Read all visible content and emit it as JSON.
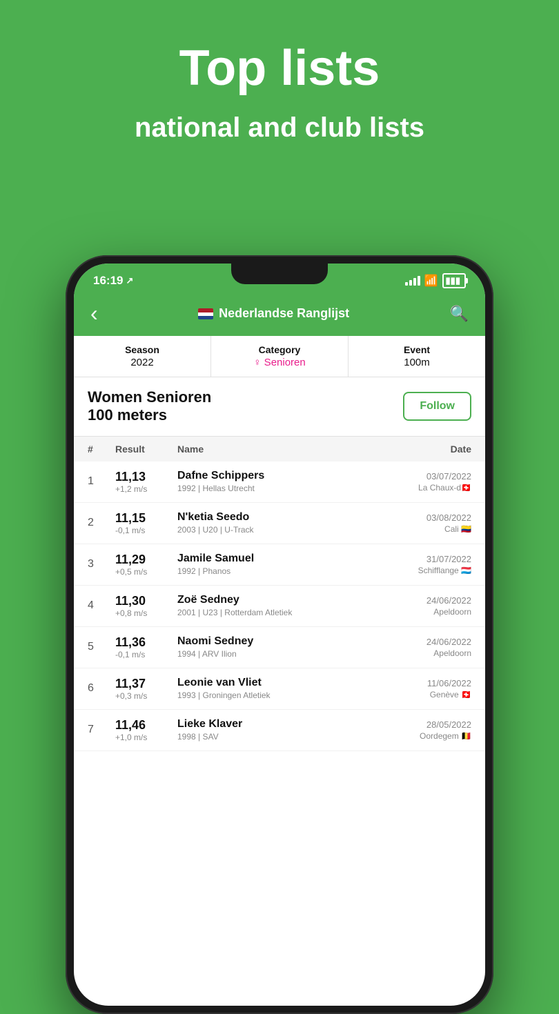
{
  "hero": {
    "title": "Top lists",
    "subtitle": "national and club lists"
  },
  "statusBar": {
    "time": "16:19",
    "hasLocation": true
  },
  "navBar": {
    "backLabel": "‹",
    "title": "Nederlandse Ranglijst",
    "searchIconLabel": "🔍"
  },
  "filters": {
    "season": {
      "label": "Season",
      "value": "2022"
    },
    "category": {
      "label": "Category",
      "value": "♀ Senioren"
    },
    "event": {
      "label": "Event",
      "value": "100m"
    }
  },
  "listTitle": {
    "heading": "Women Senioren",
    "subheading": "100 meters",
    "followButton": "Follow"
  },
  "tableHeader": {
    "rank": "#",
    "result": "Result",
    "name": "Name",
    "date": "Date"
  },
  "athletes": [
    {
      "rank": "1",
      "result": "11,13",
      "wind": "+1,2 m/s",
      "name": "Dafne Schippers",
      "info": "1992 | Hellas Utrecht",
      "date": "03/07/2022",
      "location": "La Chaux-d🇨🇭"
    },
    {
      "rank": "2",
      "result": "11,15",
      "wind": "-0,1 m/s",
      "name": "N'ketia Seedo",
      "info": "2003 | U20 | U-Track",
      "date": "03/08/2022",
      "location": "Cali 🇨🇴"
    },
    {
      "rank": "3",
      "result": "11,29",
      "wind": "+0,5 m/s",
      "name": "Jamile Samuel",
      "info": "1992 | Phanos",
      "date": "31/07/2022",
      "location": "Schifflange 🇱🇺"
    },
    {
      "rank": "4",
      "result": "11,30",
      "wind": "+0,8 m/s",
      "name": "Zoë Sedney",
      "info": "2001 | U23 | Rotterdam Atletiek",
      "date": "24/06/2022",
      "location": "Apeldoorn"
    },
    {
      "rank": "5",
      "result": "11,36",
      "wind": "-0,1 m/s",
      "name": "Naomi Sedney",
      "info": "1994 | ARV Ilion",
      "date": "24/06/2022",
      "location": "Apeldoorn"
    },
    {
      "rank": "6",
      "result": "11,37",
      "wind": "+0,3 m/s",
      "name": "Leonie van Vliet",
      "info": "1993 | Groningen Atletiek",
      "date": "11/06/2022",
      "location": "Genève 🇨🇭"
    },
    {
      "rank": "7",
      "result": "11,46",
      "wind": "+1,0 m/s",
      "name": "Lieke Klaver",
      "info": "1998 | SAV",
      "date": "28/05/2022",
      "location": "Oordegem 🇧🇪"
    }
  ]
}
